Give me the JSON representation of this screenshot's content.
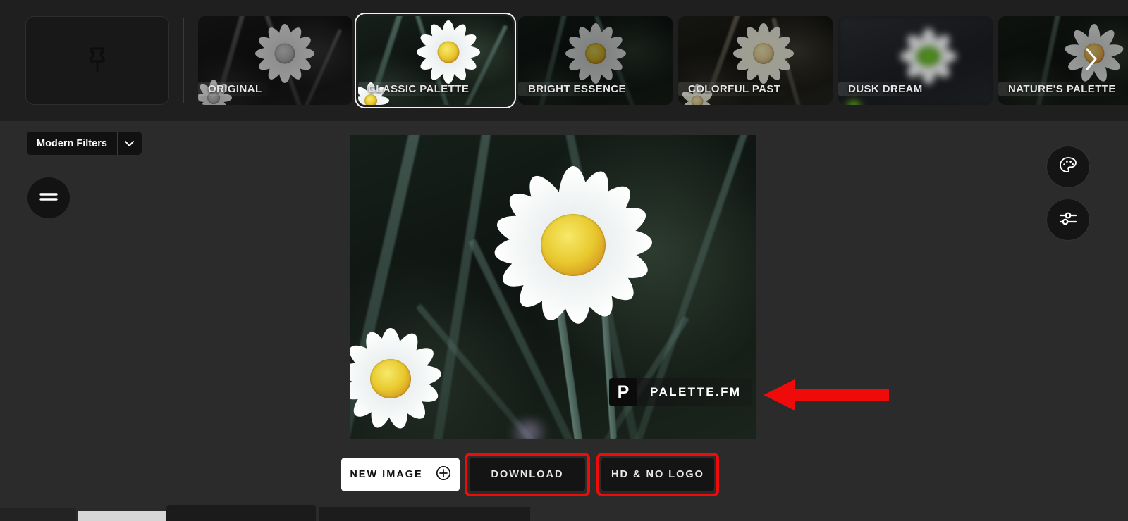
{
  "app": {
    "background_color": "#2b2b2b",
    "strip_background_color": "#1f1f1f",
    "accent_highlight_color": "#f00b0b"
  },
  "filmstrip": {
    "pin_slot": {
      "icon": "pushpin-icon",
      "label": ""
    },
    "next_arrow": "chevron-right-icon",
    "thumbnails": [
      {
        "label": "ORIGINAL",
        "style": "gray",
        "selected": false
      },
      {
        "label": "CLASSIC PALETTE",
        "style": "color",
        "selected": true
      },
      {
        "label": "BRIGHT ESSENCE",
        "style": "color",
        "selected": false
      },
      {
        "label": "COLORFUL PAST",
        "style": "sepia",
        "selected": false
      },
      {
        "label": "DUSK DREAM",
        "style": "blur",
        "selected": false
      },
      {
        "label": "NATURE'S PALETTE",
        "style": "cool",
        "selected": false
      }
    ]
  },
  "left_controls": {
    "filters_dropdown": {
      "selected": "Modern Filters",
      "caret_icon": "chevron-down-icon"
    },
    "compare_button": {
      "icon": "compare-lines-icon"
    }
  },
  "right_controls": {
    "palette_button": {
      "icon": "palette-icon"
    },
    "adjust_button": {
      "icon": "sliders-icon"
    }
  },
  "canvas": {
    "watermark": {
      "badge_letter": "P",
      "text": "PALETTE.FM"
    }
  },
  "actions": {
    "new_image": {
      "label": "NEW IMAGE",
      "icon": "plus-circle-icon",
      "highlighted": false
    },
    "download": {
      "label": "DOWNLOAD",
      "highlighted": true
    },
    "hd_no_logo": {
      "label": "HD & NO LOGO",
      "highlighted": true
    }
  },
  "annotations": {
    "arrow": {
      "direction": "left",
      "color": "#f00b0b",
      "points_at": "watermark"
    }
  }
}
